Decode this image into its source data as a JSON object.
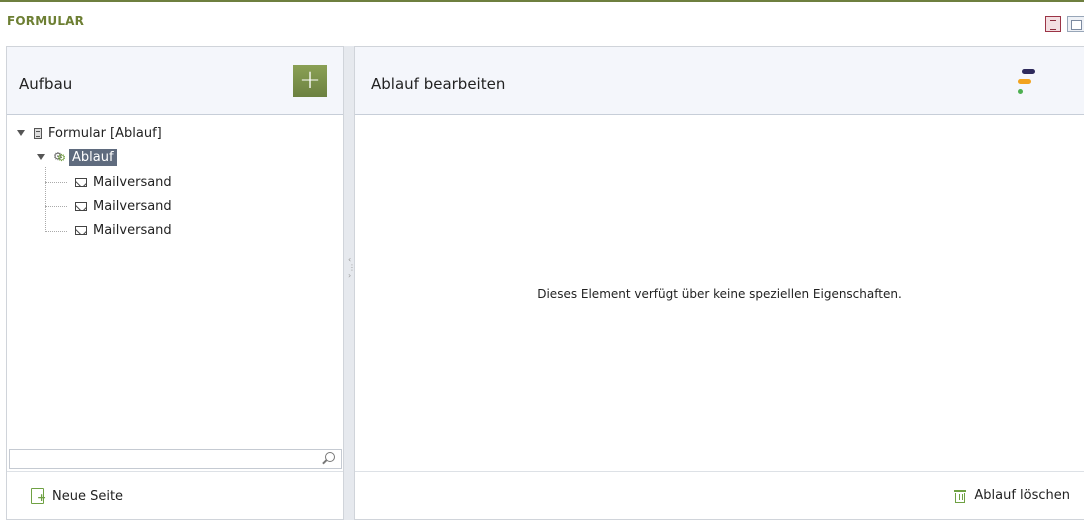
{
  "title_bar": {
    "title": "FORMULAR"
  },
  "left_panel": {
    "header_title": "Aufbau",
    "add_button_label": "+",
    "tree": [
      {
        "label": "Formular [Ablauf]",
        "level": 0,
        "expanded": true,
        "icon": "document-icon"
      },
      {
        "label": "Ablauf",
        "level": 1,
        "expanded": true,
        "icon": "gear-icon",
        "selected": true
      },
      {
        "label": "Mailversand",
        "level": 2,
        "icon": "mail-icon"
      },
      {
        "label": "Mailversand",
        "level": 2,
        "icon": "mail-icon"
      },
      {
        "label": "Mailversand",
        "level": 2,
        "icon": "mail-icon"
      }
    ],
    "search": {
      "value": "",
      "placeholder": ""
    },
    "footer_button": "Neue Seite"
  },
  "right_panel": {
    "header_title": "Ablauf bearbeiten",
    "empty_message": "Dieses Element verfügt über keine speziellen Eigenschaften.",
    "footer_button": "Ablauf löschen"
  },
  "colors": {
    "accent_green": "#6d7f33",
    "add_button": "#7a8f4a",
    "selected_bg": "#5f6b7e",
    "header_bg": "#f4f6fb"
  }
}
